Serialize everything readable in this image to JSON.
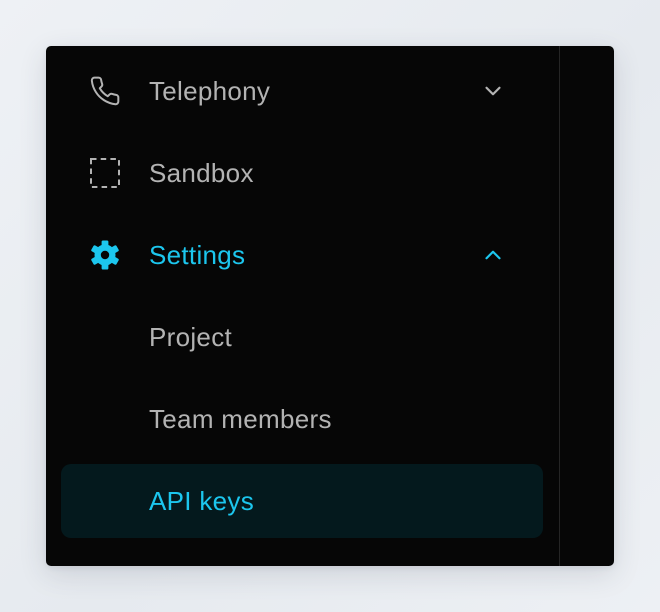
{
  "colors": {
    "accent": "#1cc6ee",
    "text_muted": "#b3b3b3",
    "panel_bg": "#060606",
    "active_bg": "#04191d"
  },
  "sidebar": {
    "items": [
      {
        "label": "Telephony",
        "icon": "phone-icon",
        "chevron": "chevron-down-icon",
        "expanded": false
      },
      {
        "label": "Sandbox",
        "icon": "dashed-square-icon",
        "expanded": false
      },
      {
        "label": "Settings",
        "icon": "gear-icon",
        "chevron": "chevron-up-icon",
        "expanded": true,
        "highlighted": true
      },
      {
        "label": "Project",
        "submenu_of": "Settings"
      },
      {
        "label": "Team members",
        "submenu_of": "Settings"
      },
      {
        "label": "API keys",
        "submenu_of": "Settings",
        "selected": true
      }
    ]
  }
}
